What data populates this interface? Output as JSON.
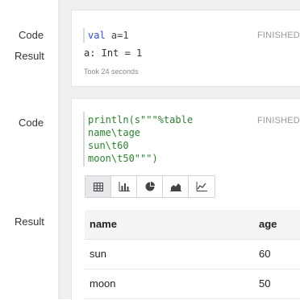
{
  "labels": {
    "code1": "Code",
    "result1": "Result",
    "code2": "Code",
    "result2": "Result"
  },
  "paragraph1": {
    "status": "FINISHED",
    "code_keyword": "val",
    "code_rest": " a=1",
    "result": "a: Int = 1",
    "took": "Took 24 seconds"
  },
  "paragraph2": {
    "status": "FINISHED",
    "code_lines": [
      "println(s\"\"\"%table",
      "name\\tage",
      "sun\\t60",
      "moon\\t50\"\"\")"
    ],
    "toolbar": [
      {
        "icon": "table-icon",
        "active": true
      },
      {
        "icon": "bar-chart-icon",
        "active": false
      },
      {
        "icon": "pie-chart-icon",
        "active": false
      },
      {
        "icon": "area-chart-icon",
        "active": false
      },
      {
        "icon": "line-chart-icon",
        "active": false
      }
    ],
    "table": {
      "headers": [
        "name",
        "age"
      ],
      "rows": [
        [
          "sun",
          "60"
        ],
        [
          "moon",
          "50"
        ]
      ]
    }
  },
  "colors": {
    "keyword": "#2f4fbf",
    "string": "#2e7d32",
    "canvas": "#eef0f2"
  }
}
